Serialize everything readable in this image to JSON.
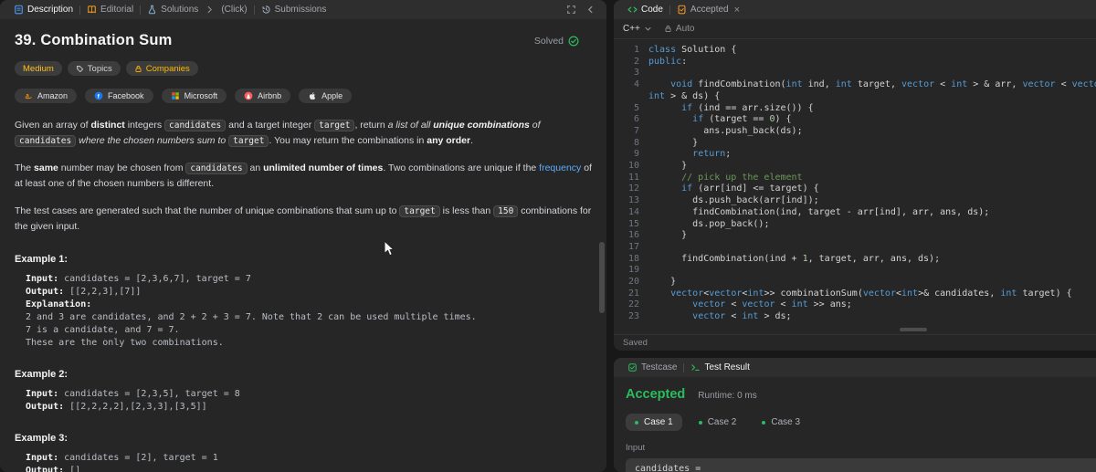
{
  "colors": {
    "accepted_green": "#2cbb5d",
    "difficulty_medium": "#ffc01e",
    "companies_amber": "#ffb800",
    "link_blue": "#5badff",
    "code_keyword": "#569cd6",
    "code_comment": "#6a9955",
    "code_number": "#b5cea8",
    "code_text": "#d4d4d4"
  },
  "left_panel": {
    "tabs": [
      {
        "label": "Description",
        "icon": "description-icon",
        "color": "#4e9bf5",
        "sep": "",
        "active": true
      },
      {
        "label": "Editorial",
        "icon": "editorial-icon",
        "color": "#ffa116",
        "sep": "bar",
        "active": false
      },
      {
        "label": "Solutions",
        "icon": "solutions-icon",
        "color": "#8fb3d9",
        "sep": "bar",
        "active": false
      },
      {
        "label": "(Click)",
        "icon": "",
        "color": "",
        "sep": "chevron",
        "active": false
      },
      {
        "label": "Submissions",
        "icon": "submissions-icon",
        "color": "#9fb0c0",
        "sep": "bar",
        "active": false
      }
    ],
    "title": "39. Combination Sum",
    "solved_label": "Solved",
    "meta_badges": [
      {
        "label": "Medium",
        "cls": "medium",
        "icon": ""
      },
      {
        "label": "Topics",
        "cls": "",
        "icon": "tag-icon"
      },
      {
        "label": "Companies",
        "cls": "companies",
        "icon": "lock-icon"
      }
    ],
    "companies": [
      {
        "name": "Amazon",
        "icon": "amazon-icon",
        "color": "#ff9900"
      },
      {
        "name": "Facebook",
        "icon": "facebook-icon",
        "color": "#1877f2"
      },
      {
        "name": "Microsoft",
        "icon": "microsoft-icon",
        "colors": [
          "#f25022",
          "#7fba00",
          "#00a4ef",
          "#ffb900"
        ]
      },
      {
        "name": "Airbnb",
        "icon": "airbnb-icon",
        "color": "#ff5a5f"
      },
      {
        "name": "Apple",
        "icon": "apple-icon",
        "color": "#e6e6e6"
      }
    ],
    "paragraphs": [
      [
        {
          "s": "p",
          "t": "Given an array of "
        },
        {
          "s": "b",
          "t": "distinct"
        },
        {
          "s": "p",
          "t": " integers "
        },
        {
          "s": "c",
          "t": "candidates"
        },
        {
          "s": "p",
          "t": " and a target integer "
        },
        {
          "s": "c",
          "t": "target"
        },
        {
          "s": "p",
          "t": ", return "
        },
        {
          "s": "i",
          "t": "a list of all "
        },
        {
          "s": "bi",
          "t": "unique combinations"
        },
        {
          "s": "i",
          "t": " of "
        },
        {
          "s": "c",
          "t": "candidates"
        },
        {
          "s": "i",
          "t": " where the chosen numbers sum to "
        },
        {
          "s": "c",
          "t": "target"
        },
        {
          "s": "p",
          "t": ". You may return the combinations in "
        },
        {
          "s": "b",
          "t": "any order"
        },
        {
          "s": "p",
          "t": "."
        }
      ],
      [
        {
          "s": "p",
          "t": "The "
        },
        {
          "s": "b",
          "t": "same"
        },
        {
          "s": "p",
          "t": " number may be chosen from "
        },
        {
          "s": "c",
          "t": "candidates"
        },
        {
          "s": "p",
          "t": " an "
        },
        {
          "s": "b",
          "t": "unlimited number of times"
        },
        {
          "s": "p",
          "t": ". Two combinations are unique if the "
        },
        {
          "s": "a",
          "t": "frequency"
        },
        {
          "s": "p",
          "t": " of at least one of the chosen numbers is different."
        }
      ],
      [
        {
          "s": "p",
          "t": "The test cases are generated such that the number of unique combinations that sum up to "
        },
        {
          "s": "c",
          "t": "target"
        },
        {
          "s": "p",
          "t": " is less than "
        },
        {
          "s": "c",
          "t": "150"
        },
        {
          "s": "p",
          "t": " combinations for the given input."
        }
      ]
    ],
    "examples": [
      {
        "label": "Example 1:",
        "lines": [
          [
            {
              "s": "b",
              "t": "Input:"
            },
            {
              "s": "p",
              "t": " candidates = [2,3,6,7], target = 7"
            }
          ],
          [
            {
              "s": "b",
              "t": "Output:"
            },
            {
              "s": "p",
              "t": " [[2,2,3],[7]]"
            }
          ],
          [
            {
              "s": "b",
              "t": "Explanation:"
            }
          ],
          [
            {
              "s": "p",
              "t": "2 and 3 are candidates, and 2 + 2 + 3 = 7. Note that 2 can be used multiple times."
            }
          ],
          [
            {
              "s": "p",
              "t": "7 is a candidate, and 7 = 7."
            }
          ],
          [
            {
              "s": "p",
              "t": "These are the only two combinations."
            }
          ]
        ]
      },
      {
        "label": "Example 2:",
        "lines": [
          [
            {
              "s": "b",
              "t": "Input:"
            },
            {
              "s": "p",
              "t": " candidates = [2,3,5], target = 8"
            }
          ],
          [
            {
              "s": "b",
              "t": "Output:"
            },
            {
              "s": "p",
              "t": " [[2,2,2,2],[2,3,3],[3,5]]"
            }
          ]
        ]
      },
      {
        "label": "Example 3:",
        "lines": [
          [
            {
              "s": "b",
              "t": "Input:"
            },
            {
              "s": "p",
              "t": " candidates = [2], target = 1"
            }
          ],
          [
            {
              "s": "b",
              "t": "Output:"
            },
            {
              "s": "p",
              "t": " []"
            }
          ]
        ]
      }
    ]
  },
  "editor": {
    "tabs": [
      "Code",
      "Accepted"
    ],
    "language": "C++",
    "auto_label": "Auto",
    "saved_label": "Saved",
    "code_lines": [
      {
        "n": 1,
        "toks": [
          {
            "c": "kw",
            "t": "class"
          },
          {
            "c": "pl",
            "t": " Solution {"
          }
        ]
      },
      {
        "n": 2,
        "toks": [
          {
            "c": "kw",
            "t": "public"
          },
          {
            "c": "pl",
            "t": ":"
          }
        ]
      },
      {
        "n": 3,
        "toks": []
      },
      {
        "n": 4,
        "toks": [
          {
            "c": "pl",
            "t": "    "
          },
          {
            "c": "kw",
            "t": "void"
          },
          {
            "c": "pl",
            "t": " findCombination("
          },
          {
            "c": "kw",
            "t": "int"
          },
          {
            "c": "pl",
            "t": " ind, "
          },
          {
            "c": "kw",
            "t": "int"
          },
          {
            "c": "pl",
            "t": " target, "
          },
          {
            "c": "kw",
            "t": "vector"
          },
          {
            "c": "pl",
            "t": " < "
          },
          {
            "c": "kw",
            "t": "int"
          },
          {
            "c": "pl",
            "t": " > & arr, "
          },
          {
            "c": "kw",
            "t": "vector"
          },
          {
            "c": "pl",
            "t": " < "
          },
          {
            "c": "kw",
            "t": "vector"
          },
          {
            "c": "pl",
            "t": " < "
          },
          {
            "c": "kw",
            "t": "int"
          },
          {
            "c": "pl",
            "t": " >> & ans, "
          },
          {
            "c": "kw",
            "t": "vector"
          },
          {
            "c": "pl",
            "t": " < "
          },
          {
            "c": "kw",
            "t": "int"
          },
          {
            "c": "pl",
            "t": " > & ds) {"
          }
        ]
      },
      {
        "n": 5,
        "toks": [
          {
            "c": "pl",
            "t": "      "
          },
          {
            "c": "kw",
            "t": "if"
          },
          {
            "c": "pl",
            "t": " (ind == arr.size()) {"
          }
        ]
      },
      {
        "n": 6,
        "toks": [
          {
            "c": "pl",
            "t": "        "
          },
          {
            "c": "kw",
            "t": "if"
          },
          {
            "c": "pl",
            "t": " (target == "
          },
          {
            "c": "num",
            "t": "0"
          },
          {
            "c": "pl",
            "t": ") {"
          }
        ]
      },
      {
        "n": 7,
        "toks": [
          {
            "c": "pl",
            "t": "          ans.push_back(ds);"
          }
        ]
      },
      {
        "n": 8,
        "toks": [
          {
            "c": "pl",
            "t": "        }"
          }
        ]
      },
      {
        "n": 9,
        "toks": [
          {
            "c": "pl",
            "t": "        "
          },
          {
            "c": "kw",
            "t": "return"
          },
          {
            "c": "pl",
            "t": ";"
          }
        ]
      },
      {
        "n": 10,
        "toks": [
          {
            "c": "pl",
            "t": "      }"
          }
        ]
      },
      {
        "n": 11,
        "toks": [
          {
            "c": "pl",
            "t": "      "
          },
          {
            "c": "cm",
            "t": "// pick up the element"
          }
        ]
      },
      {
        "n": 12,
        "toks": [
          {
            "c": "pl",
            "t": "      "
          },
          {
            "c": "kw",
            "t": "if"
          },
          {
            "c": "pl",
            "t": " (arr[ind] <= target) {"
          }
        ]
      },
      {
        "n": 13,
        "toks": [
          {
            "c": "pl",
            "t": "        ds.push_back(arr[ind]);"
          }
        ]
      },
      {
        "n": 14,
        "toks": [
          {
            "c": "pl",
            "t": "        findCombination(ind, target - arr[ind], arr, ans, ds);"
          }
        ]
      },
      {
        "n": 15,
        "toks": [
          {
            "c": "pl",
            "t": "        ds.pop_back();"
          }
        ]
      },
      {
        "n": 16,
        "toks": [
          {
            "c": "pl",
            "t": "      }"
          }
        ]
      },
      {
        "n": 17,
        "toks": []
      },
      {
        "n": 18,
        "toks": [
          {
            "c": "pl",
            "t": "      findCombination(ind + "
          },
          {
            "c": "num",
            "t": "1"
          },
          {
            "c": "pl",
            "t": ", target, arr, ans, ds);"
          }
        ]
      },
      {
        "n": 19,
        "toks": []
      },
      {
        "n": 20,
        "toks": [
          {
            "c": "pl",
            "t": "    }"
          }
        ]
      },
      {
        "n": 21,
        "toks": [
          {
            "c": "pl",
            "t": "    "
          },
          {
            "c": "kw",
            "t": "vector"
          },
          {
            "c": "pl",
            "t": "<"
          },
          {
            "c": "kw",
            "t": "vector"
          },
          {
            "c": "pl",
            "t": "<"
          },
          {
            "c": "kw",
            "t": "int"
          },
          {
            "c": "pl",
            "t": ">> combinationSum("
          },
          {
            "c": "kw",
            "t": "vector"
          },
          {
            "c": "pl",
            "t": "<"
          },
          {
            "c": "kw",
            "t": "int"
          },
          {
            "c": "pl",
            "t": ">& candidates, "
          },
          {
            "c": "kw",
            "t": "int"
          },
          {
            "c": "pl",
            "t": " target) {"
          }
        ]
      },
      {
        "n": 22,
        "toks": [
          {
            "c": "pl",
            "t": "        "
          },
          {
            "c": "kw",
            "t": "vector"
          },
          {
            "c": "pl",
            "t": " < "
          },
          {
            "c": "kw",
            "t": "vector"
          },
          {
            "c": "pl",
            "t": " < "
          },
          {
            "c": "kw",
            "t": "int"
          },
          {
            "c": "pl",
            "t": " >> ans;"
          }
        ]
      },
      {
        "n": 23,
        "toks": [
          {
            "c": "pl",
            "t": "        "
          },
          {
            "c": "kw",
            "t": "vector"
          },
          {
            "c": "pl",
            "t": " < "
          },
          {
            "c": "kw",
            "t": "int"
          },
          {
            "c": "pl",
            "t": " > ds;"
          }
        ]
      }
    ]
  },
  "results": {
    "tabs": [
      "Testcase",
      "Test Result"
    ],
    "status": "Accepted",
    "runtime": "Runtime: 0 ms",
    "cases": [
      "Case 1",
      "Case 2",
      "Case 3"
    ],
    "active_case": 0,
    "input_label": "Input",
    "input_value": "candidates ="
  }
}
